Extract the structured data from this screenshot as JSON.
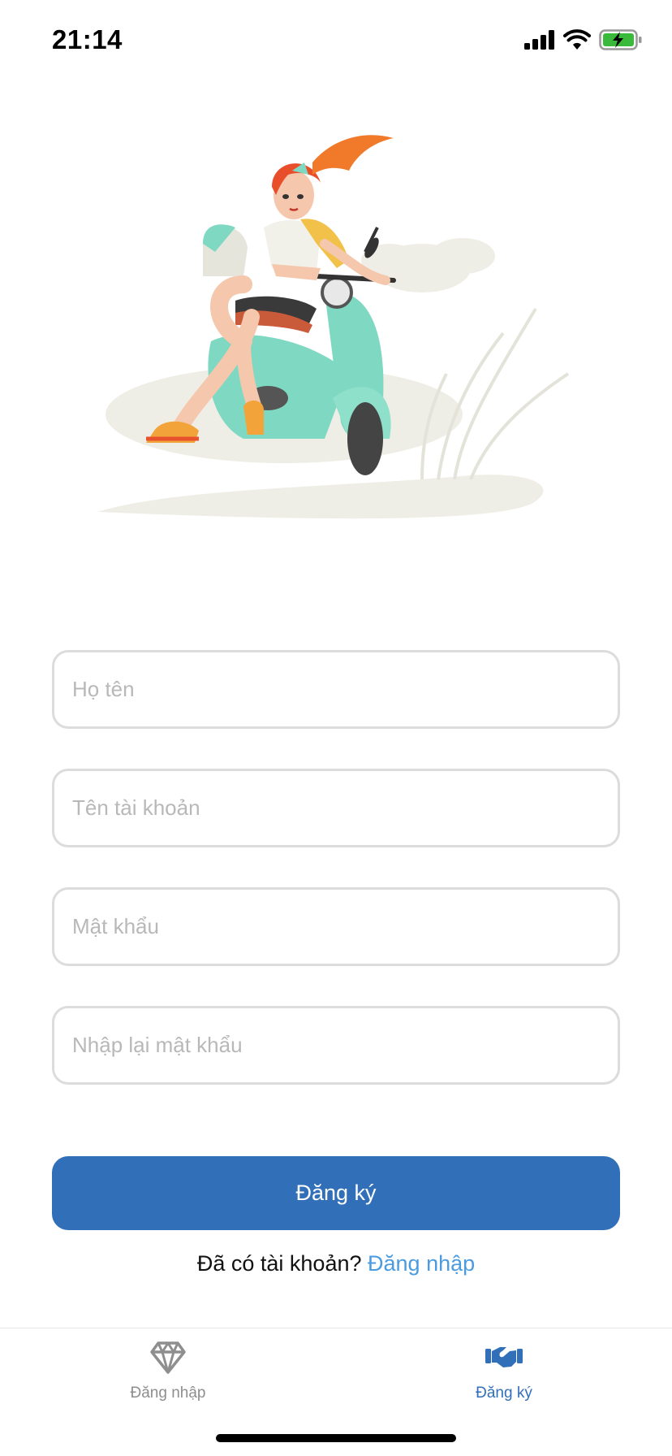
{
  "status_bar": {
    "time": "21:14",
    "battery_color": "#3aba3a"
  },
  "illustration": {
    "subject": "woman-on-scooter"
  },
  "form": {
    "full_name_placeholder": "Họ tên",
    "username_placeholder": "Tên tài khoản",
    "password_placeholder": "Mật khẩu",
    "confirm_password_placeholder": "Nhập lại mật khẩu"
  },
  "submit_label": "Đăng ký",
  "login_prompt": {
    "text": "Đã có tài khoản?",
    "link": "Đăng nhập"
  },
  "tabs": [
    {
      "label": "Đăng nhập",
      "icon": "diamond-icon",
      "active": false
    },
    {
      "label": "Đăng ký",
      "icon": "handshake-icon",
      "active": true
    }
  ],
  "colors": {
    "primary": "#3170b8",
    "link": "#4a9be0",
    "inactive": "#8e8e8e"
  }
}
